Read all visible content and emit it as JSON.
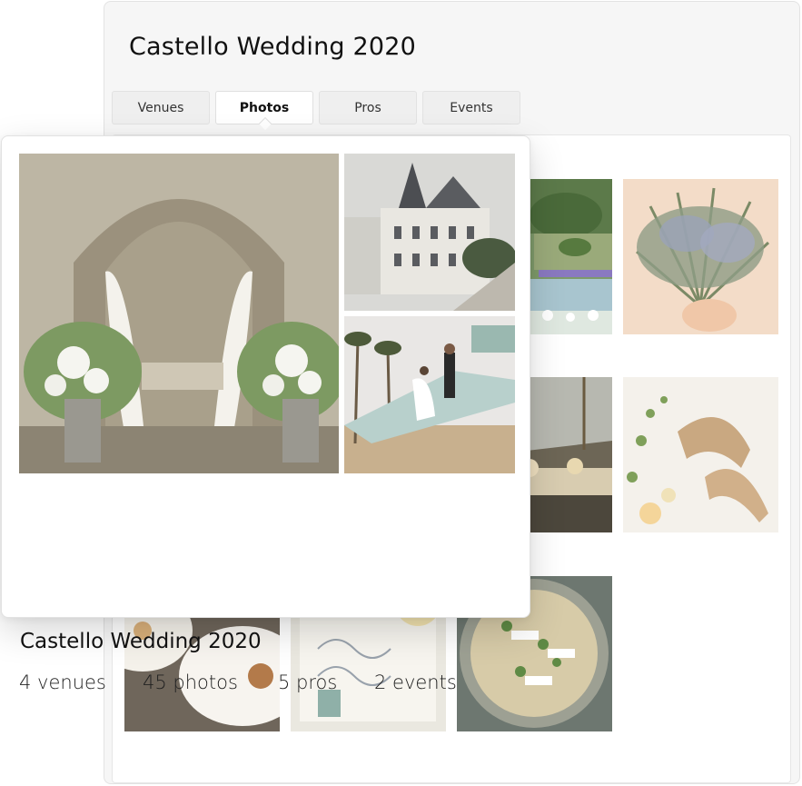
{
  "board": {
    "title": "Castello Wedding 2020",
    "tabs": [
      {
        "label": "Venues"
      },
      {
        "label": "Photos"
      },
      {
        "label": "Pros"
      },
      {
        "label": "Events"
      }
    ],
    "active_tab": "Photos"
  },
  "photo_grid": [
    {
      "subject": "garden-fountain-photo"
    },
    {
      "subject": "lavender-bouquet-photo"
    },
    {
      "subject": "tent-reception-photo"
    },
    {
      "subject": "gold-shoes-photo"
    },
    {
      "subject": "plated-dessert-photo"
    },
    {
      "subject": "calligraphy-invitation-photo"
    },
    {
      "subject": "place-cards-tray-photo"
    }
  ],
  "summary_card": {
    "title": "Castello Wedding 2020",
    "stats": [
      {
        "text": "4 venues"
      },
      {
        "text": "45 photos"
      },
      {
        "text": "5 pros"
      },
      {
        "text": "2 events"
      }
    ]
  },
  "colors": {
    "panel_background": "#f6f6f6",
    "border": "#e2e2e2",
    "text": "#111111"
  }
}
